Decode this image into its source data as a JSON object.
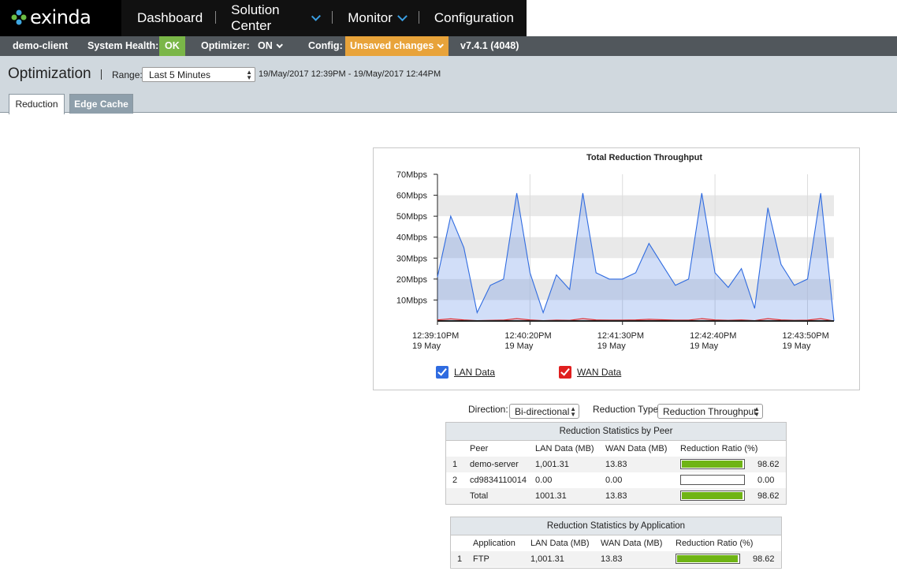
{
  "brand": {
    "name": "exinda"
  },
  "nav": {
    "items": [
      {
        "label": "Dashboard",
        "dropdown": false
      },
      {
        "label": "Solution Center",
        "dropdown": true
      },
      {
        "label": "Monitor",
        "dropdown": true
      },
      {
        "label": "Configuration",
        "dropdown": false
      }
    ]
  },
  "status": {
    "client": "demo-client",
    "health_label": "System Health:",
    "health_value": "OK",
    "optimizer_label": "Optimizer:",
    "optimizer_value": "ON",
    "config_label": "Config:",
    "config_value": "Unsaved changes",
    "version": "v7.4.1 (4048)"
  },
  "page": {
    "title": "Optimization",
    "range_label": "Range:",
    "range_value": "Last 5 Minutes",
    "range_text": "19/May/2017 12:39PM - 19/May/2017 12:44PM",
    "tabs": [
      {
        "label": "Reduction"
      },
      {
        "label": "Edge Cache"
      }
    ]
  },
  "chart_data": {
    "type": "area",
    "title": "Total Reduction Throughput",
    "y_unit": "Mbps",
    "ylim": [
      0,
      70
    ],
    "y_ticks": [
      "70Mbps",
      "60Mbps",
      "50Mbps",
      "40Mbps",
      "30Mbps",
      "20Mbps",
      "10Mbps"
    ],
    "x_ticks": [
      {
        "time": "12:39:10PM",
        "date": "19 May"
      },
      {
        "time": "12:40:20PM",
        "date": "19 May"
      },
      {
        "time": "12:41:30PM",
        "date": "19 May"
      },
      {
        "time": "12:42:40PM",
        "date": "19 May"
      },
      {
        "time": "12:43:50PM",
        "date": "19 May"
      }
    ],
    "x_seconds": [
      0,
      10,
      20,
      30,
      40,
      50,
      60,
      70,
      80,
      90,
      100,
      110,
      120,
      130,
      140,
      150,
      160,
      170,
      180,
      190,
      200,
      210,
      220,
      230,
      240,
      250,
      260,
      270,
      280,
      290,
      300
    ],
    "series": [
      {
        "name": "LAN Data",
        "color": "#2f6be0",
        "values": [
          21,
          50,
          35,
          4,
          17,
          20,
          61,
          23,
          4,
          22,
          15,
          61,
          23,
          20,
          20,
          23,
          37,
          27,
          17,
          20,
          61,
          23,
          16,
          25,
          6,
          54,
          27,
          17,
          20,
          61,
          0
        ]
      },
      {
        "name": "WAN Data",
        "color": "#e01f1f",
        "values": [
          0.5,
          1,
          0.5,
          0.2,
          0.3,
          0.4,
          1.1,
          0.5,
          0.2,
          0.4,
          0.3,
          1.1,
          0.5,
          0.4,
          0.4,
          0.5,
          0.8,
          0.6,
          0.4,
          0.4,
          1.1,
          0.5,
          0.3,
          0.5,
          0.2,
          1.1,
          0.5,
          0.3,
          0.4,
          1.1,
          0
        ]
      }
    ],
    "legend_position": "bottom"
  },
  "controls": {
    "direction_label": "Direction:",
    "direction_value": "Bi-directional",
    "type_label": "Reduction Type:",
    "type_value": "Reduction Throughput"
  },
  "peer_table": {
    "caption": "Reduction Statistics by Peer",
    "headers": [
      "Peer",
      "LAN Data (MB)",
      "WAN Data (MB)",
      "Reduction Ratio (%)"
    ],
    "rows": [
      {
        "index": "1",
        "peer": "demo-server",
        "lan": "1,001.31",
        "wan": "13.83",
        "ratio": "98.62",
        "ratio_fraction": 0.9862
      },
      {
        "index": "2",
        "peer": "cd9834110014",
        "lan": "0.00",
        "wan": "0.00",
        "ratio": "0.00",
        "ratio_fraction": 0
      },
      {
        "index": "",
        "peer": "Total",
        "lan": "1001.31",
        "wan": "13.83",
        "ratio": "98.62",
        "ratio_fraction": 0.9862
      }
    ]
  },
  "app_table": {
    "caption": "Reduction Statistics by Application",
    "headers": [
      "Application",
      "LAN Data (MB)",
      "WAN Data (MB)",
      "Reduction Ratio (%)"
    ],
    "rows": [
      {
        "index": "1",
        "app": "FTP",
        "lan": "1,001.31",
        "wan": "13.83",
        "ratio": "98.62",
        "ratio_fraction": 0.9862
      }
    ]
  }
}
